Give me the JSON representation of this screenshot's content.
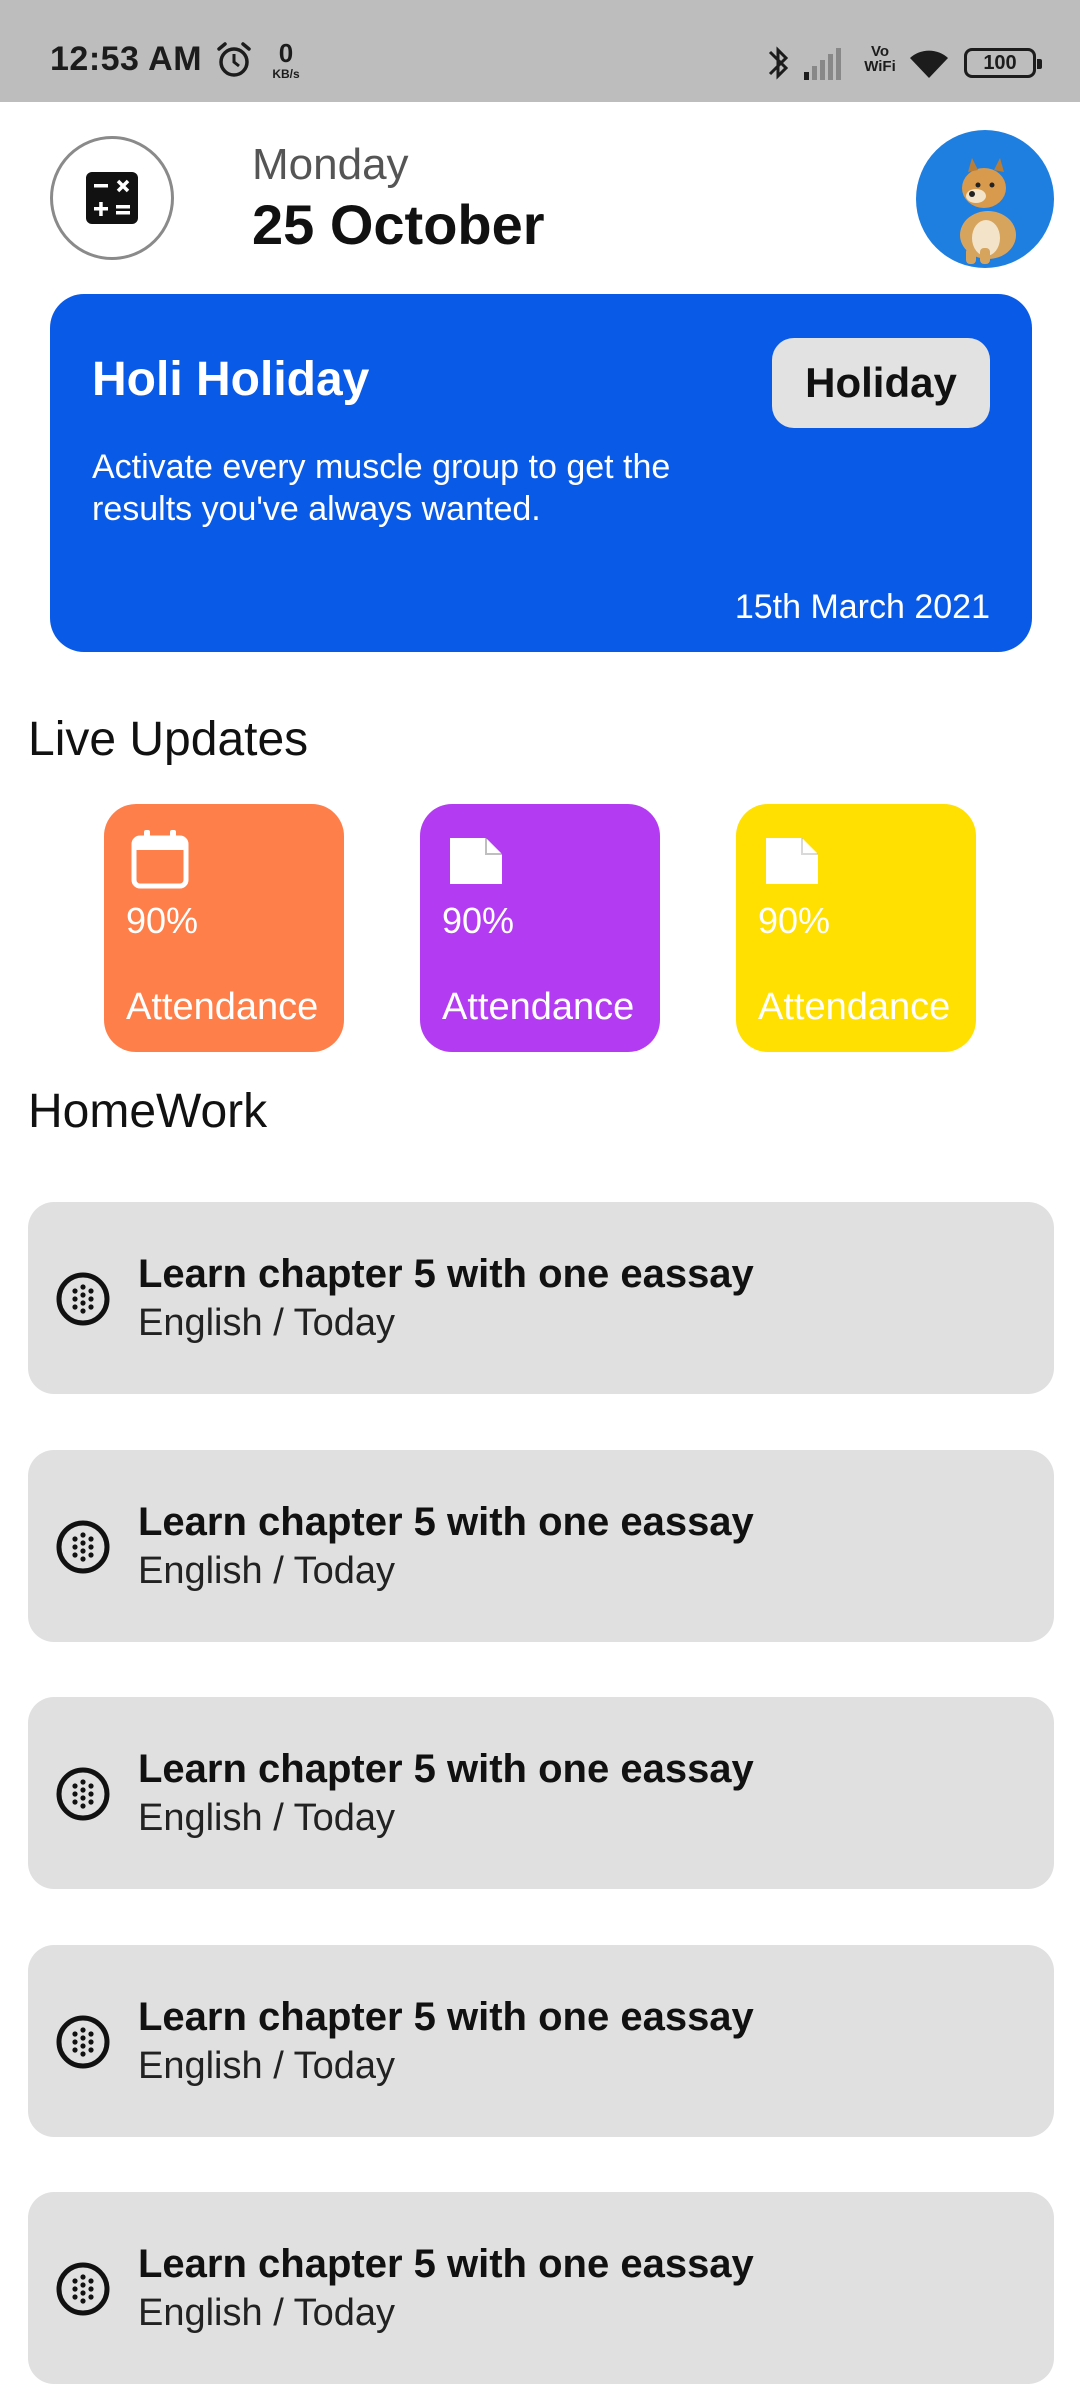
{
  "status_bar": {
    "time": "12:53 AM",
    "net_speed_value": "0",
    "net_speed_unit": "KB/s",
    "vowifi_top": "Vo",
    "vowifi_bottom": "WiFi",
    "battery": "100"
  },
  "header": {
    "day": "Monday",
    "date": "25 October"
  },
  "holiday_card": {
    "title": "Holi Holiday",
    "badge": "Holiday",
    "description": "Activate every muscle group to get the results you've always wanted.",
    "date": "15th March 2021",
    "color": "#0a5ae8"
  },
  "live_updates": {
    "title": "Live Updates",
    "tiles": [
      {
        "icon": "calendar-icon",
        "value": "90%",
        "label": "Attendance",
        "color": "#ff7f4a"
      },
      {
        "icon": "note-icon",
        "value": "90%",
        "label": "Attendance",
        "color": "#b33cf3"
      },
      {
        "icon": "note-icon",
        "value": "90%",
        "label": "Attendance",
        "color": "#ffe000"
      }
    ]
  },
  "homework": {
    "title": "HomeWork",
    "items": [
      {
        "title": "Learn chapter 5 with one eassay",
        "subtitle": "English / Today"
      },
      {
        "title": "Learn chapter 5 with one eassay",
        "subtitle": "English / Today"
      },
      {
        "title": "Learn chapter 5 with one eassay",
        "subtitle": "English / Today"
      },
      {
        "title": "Learn chapter 5 with one eassay",
        "subtitle": "English / Today"
      },
      {
        "title": "Learn chapter 5 with one eassay",
        "subtitle": "English / Today"
      }
    ]
  }
}
